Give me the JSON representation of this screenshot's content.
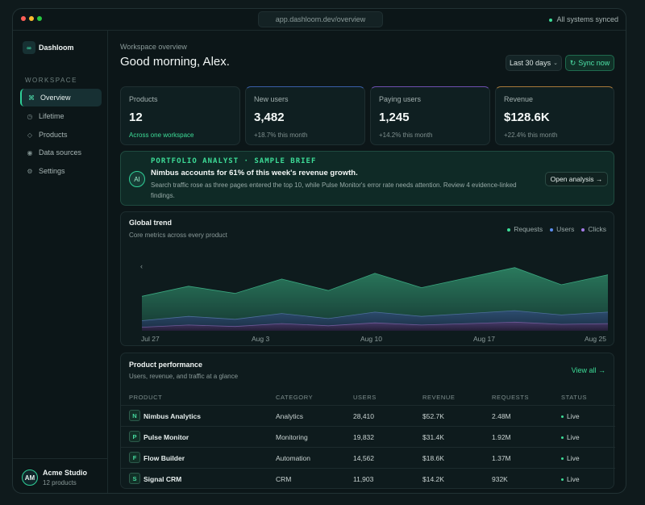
{
  "app": {
    "url": "app.dashloom.dev/overview",
    "status": "All systems synced"
  },
  "sidebar": {
    "brand": "Dashloom",
    "section": "WORKSPACE",
    "items": [
      {
        "label": "Overview",
        "icon": "command-icon"
      },
      {
        "label": "Lifetime",
        "icon": "clock-icon"
      },
      {
        "label": "Products",
        "icon": "diamond-icon"
      },
      {
        "label": "Data sources",
        "icon": "database-icon"
      },
      {
        "label": "Settings",
        "icon": "gear-icon"
      }
    ],
    "account": {
      "initials": "AM",
      "name": "Acme Studio",
      "sub": "12 products"
    }
  },
  "header": {
    "eyebrow": "Workspace overview",
    "greeting": "Good morning, Alex.",
    "range": "Last 30 days",
    "sync": "Sync now"
  },
  "stats": [
    {
      "label": "Products",
      "value": "12",
      "sub": "Across one workspace",
      "accent": "#1f2f31"
    },
    {
      "label": "New users",
      "value": "3,482",
      "sub": "+18.7% this month",
      "accent": "#3a5fa8"
    },
    {
      "label": "Paying users",
      "value": "1,245",
      "sub": "+14.2% this month",
      "accent": "#6e4fb0"
    },
    {
      "label": "Revenue",
      "value": "$128.6K",
      "sub": "+22.4% this month",
      "accent": "#a8793a"
    }
  ],
  "brief": {
    "badge": "AI",
    "kicker": "PORTFOLIO ANALYST · SAMPLE BRIEF",
    "headline": "Nimbus accounts for 61% of this week's revenue growth.",
    "body": "Search traffic rose as three pages entered the top 10, while Pulse Monitor's error rate needs attention. Review 4 evidence-linked findings.",
    "action": "Open analysis →"
  },
  "trend": {
    "title": "Global trend",
    "subtitle": "Core metrics across every product",
    "legend": [
      {
        "label": "Requests",
        "color": "#3ddc97"
      },
      {
        "label": "Users",
        "color": "#5b8def"
      },
      {
        "label": "Clicks",
        "color": "#a57be8"
      }
    ],
    "ticks": [
      "Jul 27",
      "Aug 3",
      "Aug 10",
      "Aug 17",
      "Aug 25"
    ],
    "chart_data": {
      "type": "area",
      "x": [
        "Jul 27",
        "Jul 30",
        "Aug 2",
        "Aug 5",
        "Aug 8",
        "Aug 11",
        "Aug 14",
        "Aug 17",
        "Aug 20",
        "Aug 23",
        "Aug 25"
      ],
      "series": [
        {
          "name": "Requests",
          "values": [
            0.48,
            0.62,
            0.52,
            0.72,
            0.56,
            0.8,
            0.6,
            0.74,
            0.88,
            0.64,
            0.78
          ]
        },
        {
          "name": "Users",
          "values": [
            0.14,
            0.2,
            0.16,
            0.24,
            0.17,
            0.26,
            0.2,
            0.24,
            0.28,
            0.22,
            0.26
          ]
        },
        {
          "name": "Clicks",
          "values": [
            0.05,
            0.08,
            0.06,
            0.1,
            0.07,
            0.11,
            0.08,
            0.1,
            0.12,
            0.09,
            0.1
          ]
        }
      ]
    }
  },
  "performance": {
    "title": "Product performance",
    "subtitle": "Users, revenue, and traffic at a glance",
    "view_all": "View all →",
    "columns": [
      "PRODUCT",
      "CATEGORY",
      "USERS",
      "REVENUE",
      "REQUESTS",
      "STATUS"
    ],
    "rows": [
      {
        "badge": "N",
        "name": "Nimbus Analytics",
        "category": "Analytics",
        "users": "28,410",
        "revenue": "$52.7K",
        "requests": "2.48M",
        "status": "Live"
      },
      {
        "badge": "P",
        "name": "Pulse Monitor",
        "category": "Monitoring",
        "users": "19,832",
        "revenue": "$31.4K",
        "requests": "1.92M",
        "status": "Live"
      },
      {
        "badge": "F",
        "name": "Flow Builder",
        "category": "Automation",
        "users": "14,562",
        "revenue": "$18.6K",
        "requests": "1.37M",
        "status": "Live"
      },
      {
        "badge": "S",
        "name": "Signal CRM",
        "category": "CRM",
        "users": "11,903",
        "revenue": "$14.2K",
        "requests": "932K",
        "status": "Live"
      }
    ]
  }
}
